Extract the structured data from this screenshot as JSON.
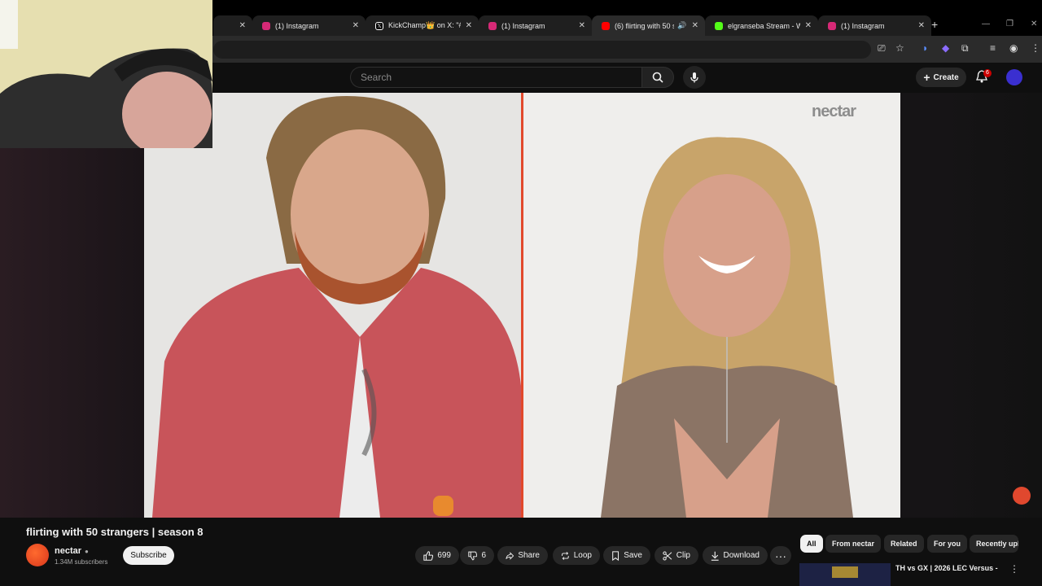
{
  "browser": {
    "tabs": [
      {
        "title": "",
        "favicon_color": "#3a3a3a",
        "active": false
      },
      {
        "title": "(1) Instagram",
        "favicon_color": "#d62976",
        "active": false
      },
      {
        "title": "KickChamp👑 on X: \"#2 ...",
        "favicon_color": "#ffffff",
        "active": false
      },
      {
        "title": "(1) Instagram",
        "favicon_color": "#d62976",
        "active": false
      },
      {
        "title": "(6) flirting with 50 stra...",
        "favicon_color": "#ff0000",
        "active": true
      },
      {
        "title": "elgranseba Stream - Watc...",
        "favicon_color": "#53fc18",
        "active": false
      },
      {
        "title": "(1) Instagram",
        "favicon_color": "#d62976",
        "active": false
      }
    ],
    "new_tab_symbol": "+",
    "close_symbol": "✕"
  },
  "youtube": {
    "search_placeholder": "Search",
    "create_label": "Create",
    "notification_count": "6"
  },
  "video": {
    "watermark": "nectar",
    "title": "flirting with 50 strangers | season 8",
    "channel_name": "nectar",
    "subscribers": "1.34M subscribers",
    "subscribe_label": "Subscribe",
    "likes": "699",
    "dislikes": "6",
    "actions": {
      "share": "Share",
      "loop": "Loop",
      "save": "Save",
      "clip": "Clip",
      "download": "Download"
    }
  },
  "chips": [
    "All",
    "From nectar",
    "Related",
    "For you",
    "Recently upl"
  ],
  "recommendation": {
    "title": "TH vs GX | 2026 LEC Versus -"
  },
  "colors": {
    "accent_red": "#e2492c",
    "yt_red": "#ff0000",
    "chip_bg": "#272727"
  }
}
